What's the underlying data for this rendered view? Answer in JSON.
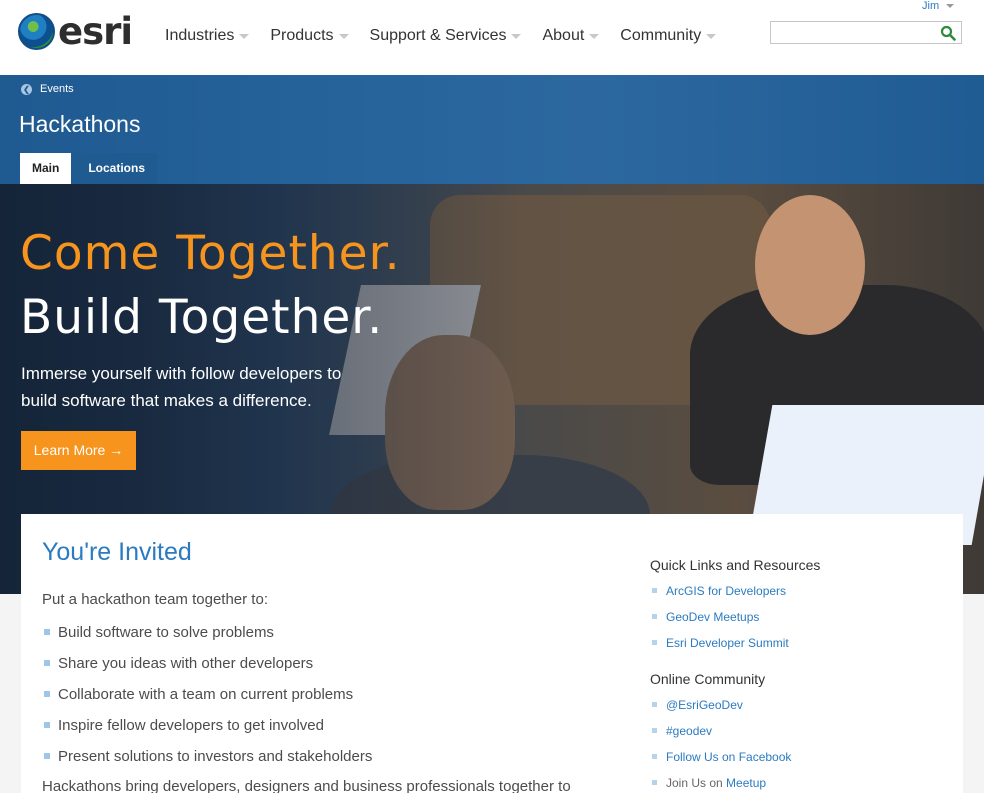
{
  "header": {
    "logo_text": "esri",
    "nav": [
      "Industries",
      "Products",
      "Support & Services",
      "About",
      "Community"
    ],
    "user": "Jim",
    "search": {
      "placeholder": "",
      "value": ""
    }
  },
  "breadcrumb": "Events",
  "page_title": "Hackathons",
  "tabs": [
    {
      "label": "Main",
      "active": true
    },
    {
      "label": "Locations",
      "active": false
    }
  ],
  "hero": {
    "headline_1": "Come Together.",
    "headline_2": "Build Together.",
    "subtext": "Immerse yourself with follow developers to build software that makes a difference.",
    "button": "Learn More →"
  },
  "main": {
    "heading": "You're Invited",
    "intro": "Put a hackathon team together to:",
    "bullets": [
      "Build software to solve problems",
      "Share you ideas with other developers",
      "Collaborate with a team on current problems",
      "Inspire fellow developers to get involved",
      "Present solutions to investors and stakeholders"
    ],
    "paragraph": "Hackathons bring developers, designers and business professionals together to"
  },
  "sidebar": {
    "quick_links_title": "Quick Links and Resources",
    "quick_links": [
      "ArcGIS for Developers",
      "GeoDev Meetups",
      "Esri Developer Summit"
    ],
    "community_title": "Online Community",
    "community_links": [
      "@EsriGeoDev",
      "#geodev",
      "Follow Us on Facebook"
    ],
    "join_prefix": "Join Us on",
    "join_link": "Meetup"
  },
  "colors": {
    "accent": "#f7941d",
    "brand_blue": "#2b7bc0",
    "header_band": "#1f5d95"
  }
}
